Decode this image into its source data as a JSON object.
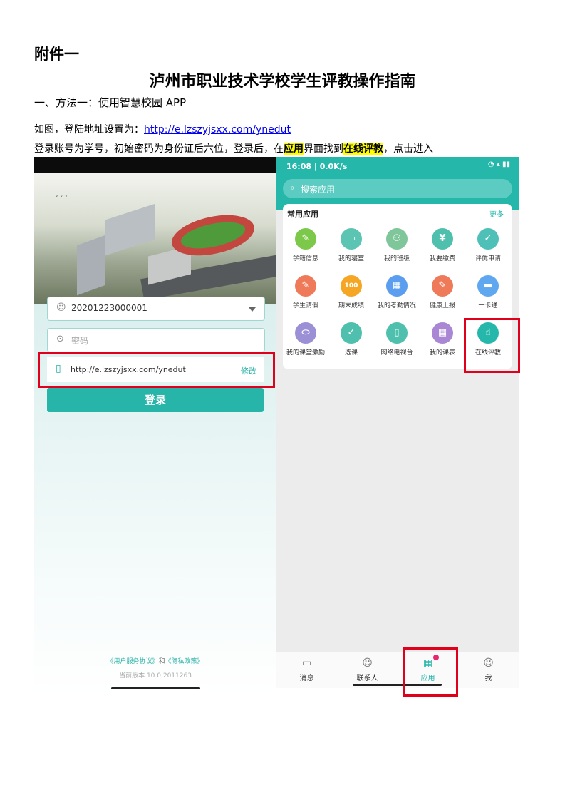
{
  "doc": {
    "attachment": "附件一",
    "title": "泸州市职业技术学校学生评教操作指南",
    "section": "一、方法一：使用智慧校园 APP",
    "para1_prefix": "如图，登陆地址设置为：",
    "para1_link": "http://e.lzszyjsxx.com/ynedut",
    "para2_a": "登录账号为学号，初始密码为身份证后六位，登录后，在",
    "para2_hl1": "应用",
    "para2_b": "界面找到",
    "para2_hl2": "在线评教",
    "para2_c": "，点击进入"
  },
  "login": {
    "account": "20201223000001",
    "password_placeholder": "密码",
    "server_url": "http://e.lzszyjsxx.com/ynedut",
    "modify": "修改",
    "login_button": "登录",
    "agreement_service": "《用户服务协议》",
    "agreement_and": "和",
    "agreement_privacy": "《隐私政策》",
    "version": "当前版本 10.0.2011263"
  },
  "apps": {
    "status_time": "16:08 | 0.0K/s",
    "search_placeholder": "搜索应用",
    "section_title": "常用应用",
    "more": "更多",
    "items": [
      {
        "label": "学籍信息",
        "color": "#7cc84a",
        "glyph": "✎"
      },
      {
        "label": "我的寝室",
        "color": "#5cc4b2",
        "glyph": "▭"
      },
      {
        "label": "我的班级",
        "color": "#7fc79a",
        "glyph": "⚇"
      },
      {
        "label": "我要缴费",
        "color": "#4fc0ad",
        "glyph": "¥"
      },
      {
        "label": "评优申请",
        "color": "#4fc0b7",
        "glyph": "✓"
      },
      {
        "label": "学生请假",
        "color": "#ef7a5a",
        "glyph": "✎"
      },
      {
        "label": "期末成绩",
        "color": "#f5a623",
        "glyph": "100"
      },
      {
        "label": "我的考勤情况",
        "color": "#5b9ef0",
        "glyph": "▦"
      },
      {
        "label": "健康上报",
        "color": "#ef7a5a",
        "glyph": "✎"
      },
      {
        "label": "一卡通",
        "color": "#5fa8ef",
        "glyph": "▬"
      },
      {
        "label": "我的课堂激励",
        "color": "#9b8fd6",
        "glyph": "⬭"
      },
      {
        "label": "选课",
        "color": "#4fc0ad",
        "glyph": "✓"
      },
      {
        "label": "网络电视台",
        "color": "#4fc0ad",
        "glyph": "▯"
      },
      {
        "label": "我的课表",
        "color": "#a987d4",
        "glyph": "▦"
      },
      {
        "label": "在线评教",
        "color": "#26b7ab",
        "glyph": "☝"
      }
    ],
    "tabs": [
      {
        "label": "消息",
        "glyph": "▭"
      },
      {
        "label": "联系人",
        "glyph": "☺"
      },
      {
        "label": "应用",
        "glyph": "▦"
      },
      {
        "label": "我",
        "glyph": "☺"
      }
    ]
  }
}
